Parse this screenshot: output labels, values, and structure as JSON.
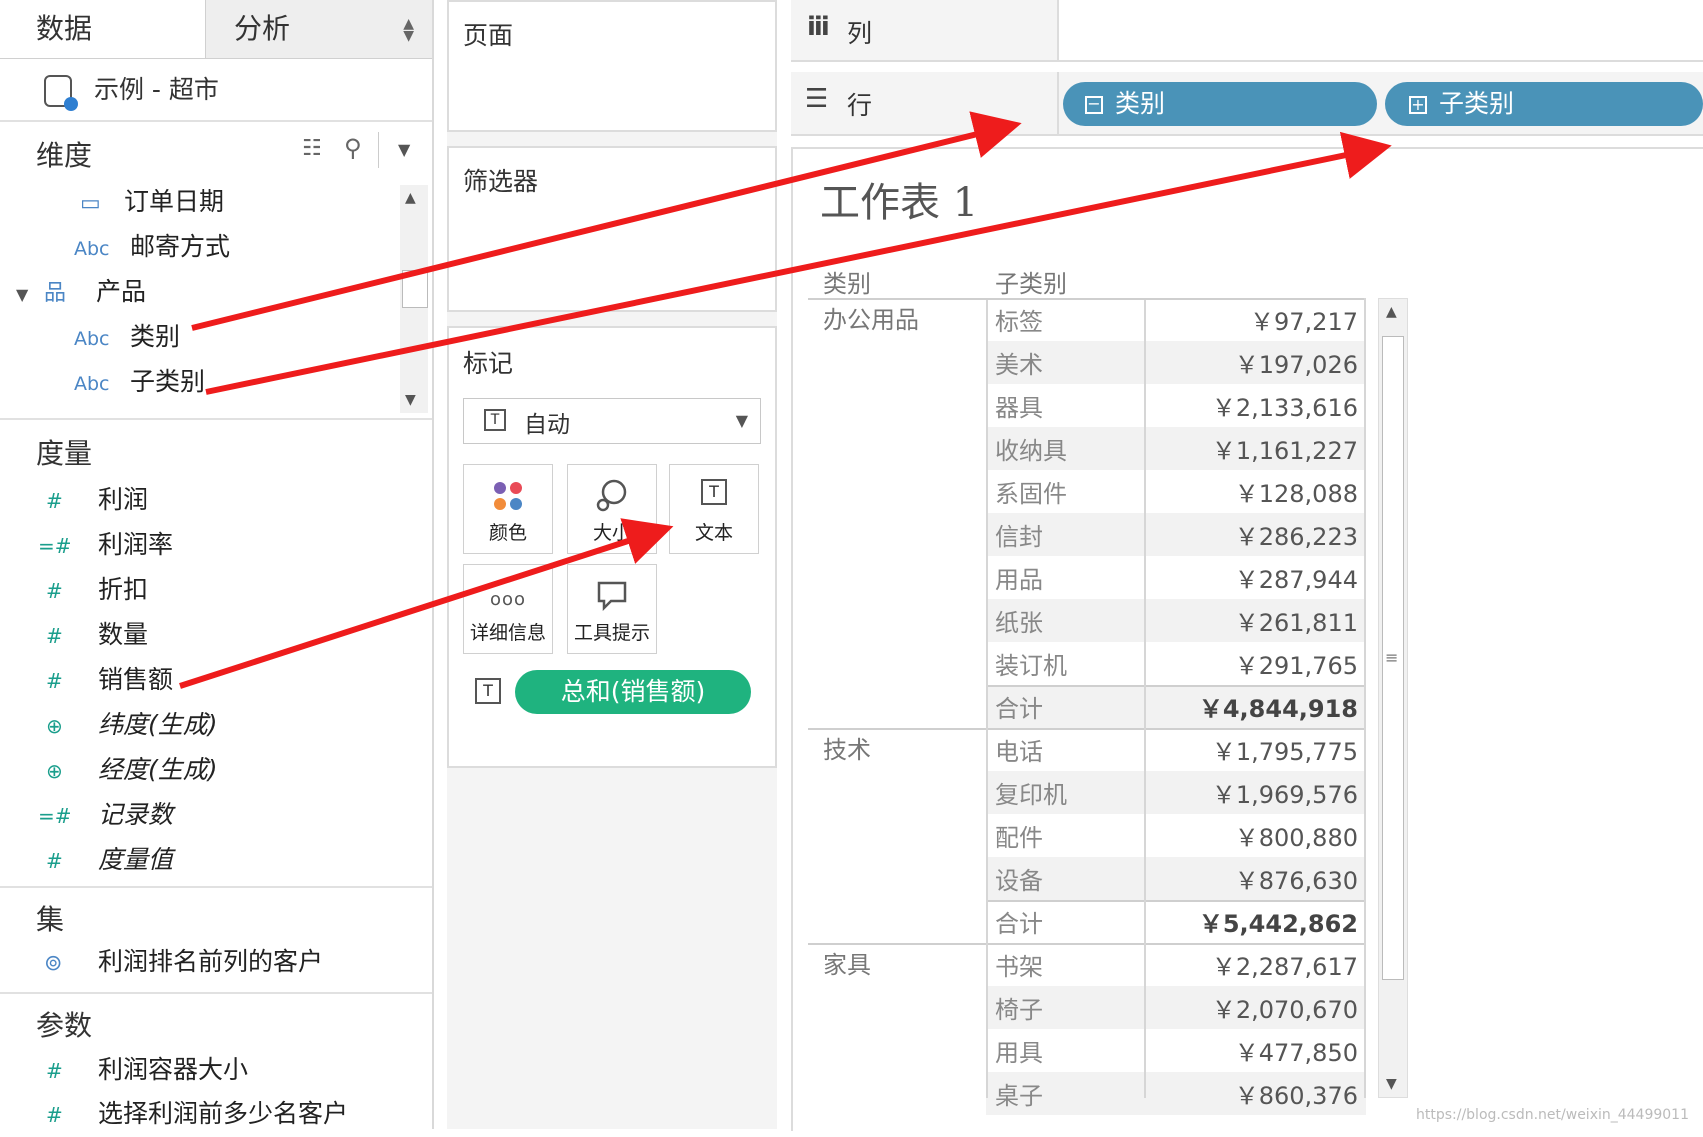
{
  "tabs": {
    "data": "数据",
    "analysis": "分析"
  },
  "datasource": "示例 - 超市",
  "dimensions": {
    "title": "维度",
    "items": [
      {
        "icon": "calendar-icon",
        "glyph": "▭",
        "label": "订单日期"
      },
      {
        "icon": "abc-icon",
        "glyph": "Abc",
        "label": "邮寄方式"
      },
      {
        "icon": "hierarchy-icon",
        "glyph": "品",
        "label": "产品"
      },
      {
        "icon": "abc-icon",
        "glyph": "Abc",
        "label": "类别"
      },
      {
        "icon": "abc-icon",
        "glyph": "Abc",
        "label": "子类别"
      }
    ]
  },
  "measures": {
    "title": "度量",
    "items": [
      {
        "icon": "hash-icon",
        "glyph": "#",
        "label": "利润"
      },
      {
        "icon": "calc-hash-icon",
        "glyph": "=#",
        "label": "利润率"
      },
      {
        "icon": "hash-icon",
        "glyph": "#",
        "label": "折扣"
      },
      {
        "icon": "hash-icon",
        "glyph": "#",
        "label": "数量"
      },
      {
        "icon": "hash-icon",
        "glyph": "#",
        "label": "销售额"
      },
      {
        "icon": "globe-icon",
        "glyph": "⊕",
        "label": "纬度(生成)"
      },
      {
        "icon": "globe-icon",
        "glyph": "⊕",
        "label": "经度(生成)"
      },
      {
        "icon": "calc-hash-icon",
        "glyph": "=#",
        "label": "记录数"
      },
      {
        "icon": "hash-icon",
        "glyph": "#",
        "label": "度量值"
      }
    ]
  },
  "sets": {
    "title": "集",
    "items": [
      {
        "label": "利润排名前列的客户"
      }
    ]
  },
  "params": {
    "title": "参数",
    "items": [
      {
        "glyph": "#",
        "label": "利润容器大小"
      },
      {
        "glyph": "#",
        "label": "选择利润前多少名客户"
      }
    ]
  },
  "pages_card": "页面",
  "filters_card": "筛选器",
  "marks": {
    "title": "标记",
    "type": "自动",
    "buttons": {
      "color": "颜色",
      "size": "大小",
      "text": "文本",
      "detail": "详细信息",
      "tooltip": "工具提示"
    },
    "text_pill": "总和(销售额)"
  },
  "columns_shelf": "列",
  "rows_shelf": "行",
  "row_pills": [
    "类别",
    "子类别"
  ],
  "worksheet": {
    "title": "工作表 1",
    "headers": [
      "类别",
      "子类别"
    ],
    "groups": [
      {
        "category": "办公用品",
        "rows": [
          {
            "sub": "标签",
            "value": "￥97,217"
          },
          {
            "sub": "美术",
            "value": "￥197,026"
          },
          {
            "sub": "器具",
            "value": "￥2,133,616"
          },
          {
            "sub": "收纳具",
            "value": "￥1,161,227"
          },
          {
            "sub": "系固件",
            "value": "￥128,088"
          },
          {
            "sub": "信封",
            "value": "￥286,223"
          },
          {
            "sub": "用品",
            "value": "￥287,944"
          },
          {
            "sub": "纸张",
            "value": "￥261,811"
          },
          {
            "sub": "装订机",
            "value": "￥291,765"
          },
          {
            "sub": "合计",
            "value": "￥4,844,918",
            "total": true
          }
        ]
      },
      {
        "category": "技术",
        "rows": [
          {
            "sub": "电话",
            "value": "￥1,795,775"
          },
          {
            "sub": "复印机",
            "value": "￥1,969,576"
          },
          {
            "sub": "配件",
            "value": "￥800,880"
          },
          {
            "sub": "设备",
            "value": "￥876,630"
          },
          {
            "sub": "合计",
            "value": "￥5,442,862",
            "total": true
          }
        ]
      },
      {
        "category": "家具",
        "rows": [
          {
            "sub": "书架",
            "value": "￥2,287,617"
          },
          {
            "sub": "椅子",
            "value": "￥2,070,670"
          },
          {
            "sub": "用具",
            "value": "￥477,850"
          },
          {
            "sub": "桌子",
            "value": "￥860,376"
          }
        ]
      }
    ]
  },
  "watermark": "https://blog.csdn.net/weixin_44499011",
  "colors": {
    "pill_blue": "#4a93b8",
    "pill_green": "#1fb37f",
    "arrow_red": "#ee1c1c",
    "field_icon": "#1a9e8c"
  }
}
